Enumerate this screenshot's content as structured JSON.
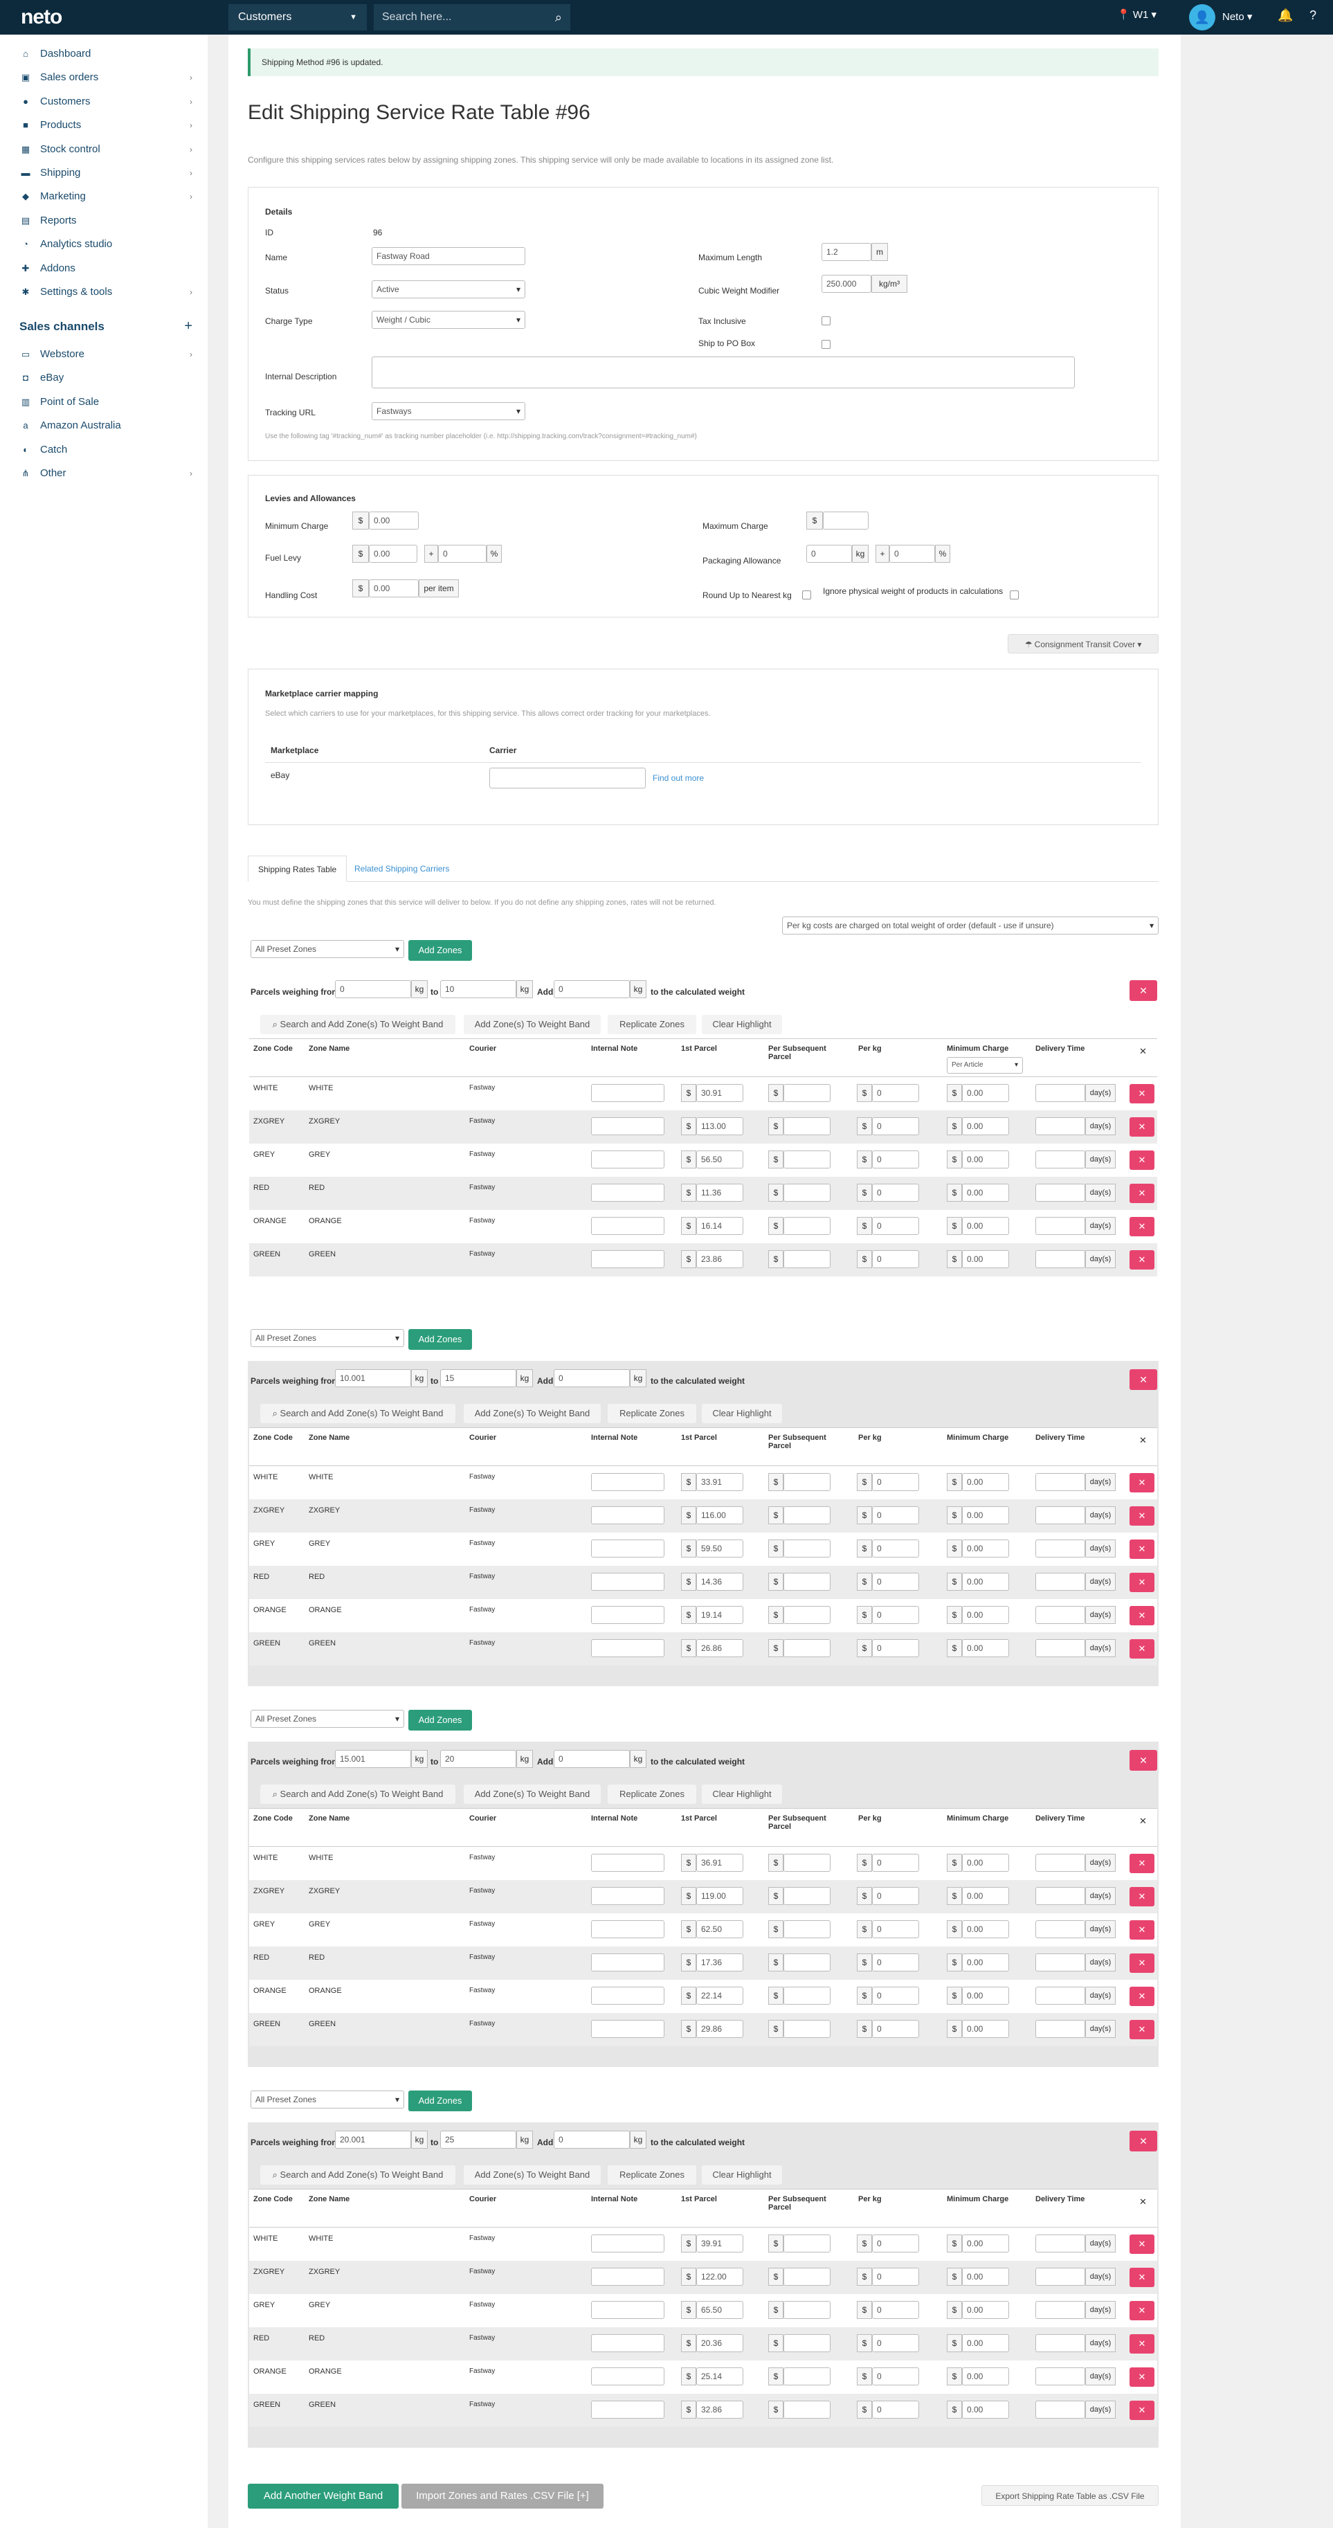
{
  "topbar": {
    "logo": "neto",
    "store_select": "Customers",
    "search_placeholder": "Search here...",
    "location": "W1",
    "user": "Neto",
    "colors": {
      "bar": "#0d2a3d",
      "accent": "#2b9d7a",
      "danger": "#e8436f"
    }
  },
  "sidebar": {
    "items": [
      {
        "label": "Dashboard",
        "icon": "home-icon",
        "chev": false
      },
      {
        "label": "Sales orders",
        "icon": "cart-icon",
        "chev": true
      },
      {
        "label": "Customers",
        "icon": "user-icon",
        "chev": true
      },
      {
        "label": "Products",
        "icon": "box-icon",
        "chev": true
      },
      {
        "label": "Stock control",
        "icon": "warehouse-icon",
        "chev": true
      },
      {
        "label": "Shipping",
        "icon": "truck-icon",
        "chev": true
      },
      {
        "label": "Marketing",
        "icon": "tag-icon",
        "chev": true
      },
      {
        "label": "Reports",
        "icon": "chart-icon",
        "chev": false
      },
      {
        "label": "Analytics studio",
        "icon": "analytics-icon",
        "chev": false
      },
      {
        "label": "Addons",
        "icon": "addon-icon",
        "chev": false
      },
      {
        "label": "Settings & tools",
        "icon": "gear-icon",
        "chev": true
      }
    ],
    "channels_title": "Sales channels",
    "channels": [
      {
        "label": "Webstore",
        "icon": "monitor-icon",
        "chev": true
      },
      {
        "label": "eBay",
        "icon": "bag-icon",
        "chev": false
      },
      {
        "label": "Point of Sale",
        "icon": "pos-icon",
        "chev": false
      },
      {
        "label": "Amazon Australia",
        "icon": "amazon-icon",
        "chev": false
      },
      {
        "label": "Catch",
        "icon": "catch-icon",
        "chev": false
      },
      {
        "label": "Other",
        "icon": "network-icon",
        "chev": true
      }
    ]
  },
  "alert": "Shipping Method #96 is updated.",
  "page_title": "Edit Shipping Service Rate Table #96",
  "description": "Configure this shipping services rates below by assigning shipping zones. This shipping service will only be made available to locations in its assigned zone list.",
  "details": {
    "title": "Details",
    "id_label": "ID",
    "id_value": "96",
    "name_label": "Name",
    "name_value": "Fastway Road",
    "status_label": "Status",
    "status_value": "Active",
    "charge_type_label": "Charge Type",
    "charge_type_value": "Weight / Cubic",
    "internal_desc_label": "Internal Description",
    "tracking_label": "Tracking URL",
    "tracking_value": "Fastways",
    "tracking_hint": "Use the following tag '#tracking_num#' as tracking number placeholder (i.e. http://shipping.tracking.com/track?consignment=#tracking_num#)",
    "max_length_label": "Maximum Length",
    "max_length_value": "1.2",
    "max_length_unit": "m",
    "cubic_label": "Cubic Weight Modifier",
    "cubic_value": "250.000",
    "cubic_unit": "kg/m³",
    "tax_label": "Tax Inclusive",
    "po_label": "Ship to PO Box"
  },
  "levies": {
    "title": "Levies and Allowances",
    "min_charge_label": "Minimum Charge",
    "min_charge_value": "0.00",
    "fuel_label": "Fuel Levy",
    "fuel_value": "0.00",
    "fuel_pct": "0",
    "handling_label": "Handling Cost",
    "handling_value": "0.00",
    "handling_unit": "per item",
    "max_charge_label": "Maximum Charge",
    "packaging_label": "Packaging Allowance",
    "packaging_kg": "0",
    "packaging_pct": "0",
    "roundup_label": "Round Up to Nearest kg",
    "ignore_label": "Ignore physical weight of products in calculations",
    "currency": "$",
    "plus": "+",
    "pct": "%",
    "kg": "kg"
  },
  "consignment_btn": "Consignment Transit Cover",
  "marketplace": {
    "title": "Marketplace carrier mapping",
    "desc": "Select which carriers to use for your marketplaces, for this shipping service. This allows correct order tracking for your marketplaces.",
    "col_marketplace": "Marketplace",
    "col_carrier": "Carrier",
    "row_marketplace": "eBay",
    "find_out_more": "Find out more"
  },
  "tabs": [
    "Shipping Rates Table",
    "Related Shipping Carriers"
  ],
  "rates_note": "You must define the shipping zones that this service will deliver to below. If you do not define any shipping zones, rates will not be returned.",
  "perkg_select": "Per kg costs are charged on total weight of order (default - use if unsure)",
  "band_labels": {
    "preset": "All Preset Zones",
    "add_zones": "Add Zones",
    "weighing_from": "Parcels weighing from",
    "to": "to",
    "add": "Add",
    "kg": "kg",
    "calc": "to the calculated weight",
    "search_add": "Search and Add Zone(s) To Weight Band",
    "add_zone": "Add Zone(s) To Weight Band",
    "replicate": "Replicate Zones",
    "clear": "Clear Highlight",
    "headers": {
      "code": "Zone Code",
      "name": "Zone Name",
      "courier": "Courier",
      "note": "Internal Note",
      "first": "1st Parcel",
      "subseq": "Per Subsequent Parcel",
      "perkg": "Per kg",
      "min": "Minimum Charge",
      "delivery": "Delivery Time"
    },
    "per_article": "Per Article",
    "days": "day(s)",
    "currency": "$",
    "perkg_default": "0",
    "min_default": "0.00"
  },
  "bands": [
    {
      "from": "0",
      "to": "10",
      "add": "0",
      "rows": [
        {
          "code": "WHITE",
          "name": "WHITE",
          "courier": "Fastway",
          "first": "30.91"
        },
        {
          "code": "ZXGREY",
          "name": "ZXGREY",
          "courier": "Fastway",
          "first": "113.00"
        },
        {
          "code": "GREY",
          "name": "GREY",
          "courier": "Fastway",
          "first": "56.50"
        },
        {
          "code": "RED",
          "name": "RED",
          "courier": "Fastway",
          "first": "11.36"
        },
        {
          "code": "ORANGE",
          "name": "ORANGE",
          "courier": "Fastway",
          "first": "16.14"
        },
        {
          "code": "GREEN",
          "name": "GREEN",
          "courier": "Fastway",
          "first": "23.86"
        }
      ]
    },
    {
      "from": "10.001",
      "to": "15",
      "add": "0",
      "rows": [
        {
          "code": "WHITE",
          "name": "WHITE",
          "courier": "Fastway",
          "first": "33.91"
        },
        {
          "code": "ZXGREY",
          "name": "ZXGREY",
          "courier": "Fastway",
          "first": "116.00"
        },
        {
          "code": "GREY",
          "name": "GREY",
          "courier": "Fastway",
          "first": "59.50"
        },
        {
          "code": "RED",
          "name": "RED",
          "courier": "Fastway",
          "first": "14.36"
        },
        {
          "code": "ORANGE",
          "name": "ORANGE",
          "courier": "Fastway",
          "first": "19.14"
        },
        {
          "code": "GREEN",
          "name": "GREEN",
          "courier": "Fastway",
          "first": "26.86"
        }
      ]
    },
    {
      "from": "15.001",
      "to": "20",
      "add": "0",
      "rows": [
        {
          "code": "WHITE",
          "name": "WHITE",
          "courier": "Fastway",
          "first": "36.91"
        },
        {
          "code": "ZXGREY",
          "name": "ZXGREY",
          "courier": "Fastway",
          "first": "119.00"
        },
        {
          "code": "GREY",
          "name": "GREY",
          "courier": "Fastway",
          "first": "62.50"
        },
        {
          "code": "RED",
          "name": "RED",
          "courier": "Fastway",
          "first": "17.36"
        },
        {
          "code": "ORANGE",
          "name": "ORANGE",
          "courier": "Fastway",
          "first": "22.14"
        },
        {
          "code": "GREEN",
          "name": "GREEN",
          "courier": "Fastway",
          "first": "29.86"
        }
      ]
    },
    {
      "from": "20.001",
      "to": "25",
      "add": "0",
      "rows": [
        {
          "code": "WHITE",
          "name": "WHITE",
          "courier": "Fastway",
          "first": "39.91"
        },
        {
          "code": "ZXGREY",
          "name": "ZXGREY",
          "courier": "Fastway",
          "first": "122.00"
        },
        {
          "code": "GREY",
          "name": "GREY",
          "courier": "Fastway",
          "first": "65.50"
        },
        {
          "code": "RED",
          "name": "RED",
          "courier": "Fastway",
          "first": "20.36"
        },
        {
          "code": "ORANGE",
          "name": "ORANGE",
          "courier": "Fastway",
          "first": "25.14"
        },
        {
          "code": "GREEN",
          "name": "GREEN",
          "courier": "Fastway",
          "first": "32.86"
        }
      ]
    }
  ],
  "footer": {
    "add_band": "Add Another Weight Band",
    "import_csv": "Import Zones and Rates .CSV File [+]",
    "export_csv": "Export Shipping Rate Table as .CSV File"
  }
}
